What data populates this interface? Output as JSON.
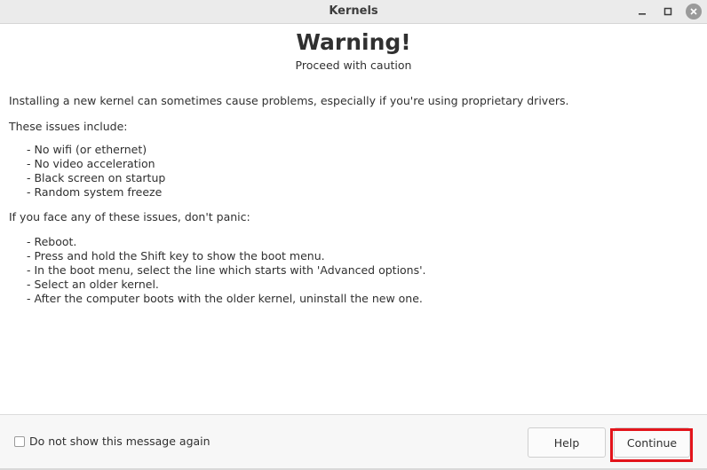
{
  "window": {
    "title": "Kernels"
  },
  "heading": {
    "title": "Warning!",
    "subtitle": "Proceed with caution"
  },
  "body": {
    "intro": "Installing a new kernel can sometimes cause problems, especially if you're using proprietary drivers.",
    "issues_label": "These issues include:",
    "issues": [
      "- No wifi (or ethernet)",
      "- No video acceleration",
      "- Black screen on startup",
      "- Random system freeze"
    ],
    "panic_label": "If you face any of these issues, don't panic:",
    "steps": [
      "- Reboot.",
      "- Press and hold the Shift key to show the boot menu.",
      "- In the boot menu, select the line which starts with 'Advanced options'.",
      "- Select an older kernel.",
      "- After the computer boots with the older kernel, uninstall the new one."
    ]
  },
  "footer": {
    "checkbox_label": "Do not show this message again",
    "checkbox_checked": false,
    "help_label": "Help",
    "continue_label": "Continue"
  },
  "colors": {
    "highlight": "#e3141b",
    "titlebar": "#ebebeb",
    "text": "#303030"
  },
  "icons": {
    "minimize": "minimize-icon",
    "maximize": "maximize-icon",
    "close": "close-icon"
  }
}
